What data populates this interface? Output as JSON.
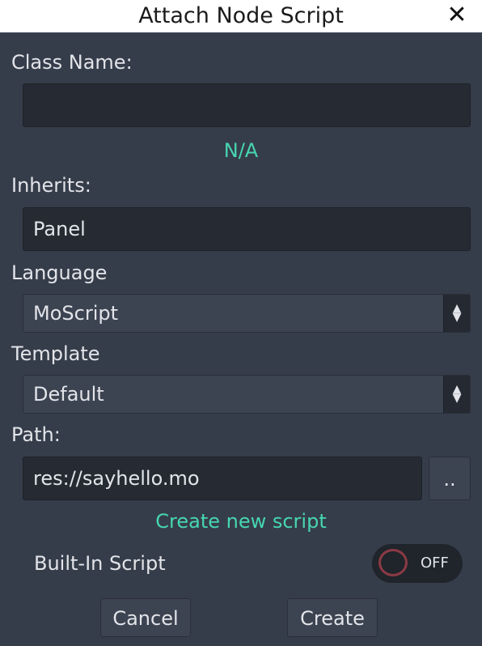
{
  "dialog": {
    "title": "Attach Node Script",
    "close_glyph": "✕"
  },
  "class_name": {
    "label": "Class Name:",
    "value": "",
    "status": "N/A"
  },
  "inherits": {
    "label": "Inherits:",
    "value": "Panel"
  },
  "language": {
    "label": "Language",
    "selected": "MoScript"
  },
  "template": {
    "label": "Template",
    "selected": "Default"
  },
  "path": {
    "label": "Path:",
    "value": "res://sayhello.mo",
    "browse_label": "..",
    "status": "Create new script"
  },
  "builtin": {
    "label": "Built-In Script",
    "toggle_text": "OFF",
    "enabled": false
  },
  "buttons": {
    "cancel": "Cancel",
    "create": "Create"
  },
  "colors": {
    "accent": "#46d7b1",
    "background": "#363d4a",
    "toggle_off": "#8b3a44"
  }
}
